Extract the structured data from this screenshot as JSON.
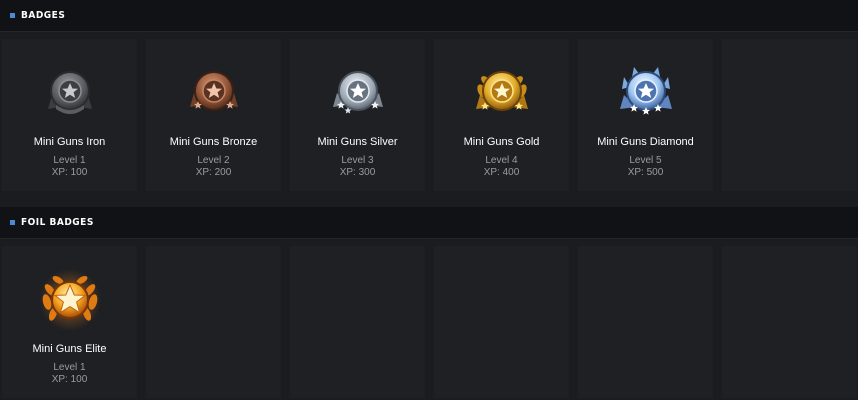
{
  "sections": [
    {
      "title": "BADGES",
      "badges": [
        {
          "name": "Mini Guns Iron",
          "level": "Level 1",
          "xp": "XP: 100",
          "icon": "iron-badge-icon"
        },
        {
          "name": "Mini Guns Bronze",
          "level": "Level 2",
          "xp": "XP: 200",
          "icon": "bronze-badge-icon"
        },
        {
          "name": "Mini Guns Silver",
          "level": "Level 3",
          "xp": "XP: 300",
          "icon": "silver-badge-icon"
        },
        {
          "name": "Mini Guns Gold",
          "level": "Level 4",
          "xp": "XP: 400",
          "icon": "gold-badge-icon"
        },
        {
          "name": "Mini Guns Diamond",
          "level": "Level 5",
          "xp": "XP: 500",
          "icon": "diamond-badge-icon"
        }
      ]
    },
    {
      "title": "FOIL BADGES",
      "badges": [
        {
          "name": "Mini Guns Elite",
          "level": "Level 1",
          "xp": "XP: 100",
          "icon": "elite-foil-badge-icon"
        }
      ]
    }
  ],
  "colors": {
    "accent": "#4d8ad6",
    "iron": "#6b6d72",
    "bronze": "#9a5a3d",
    "silver": "#b9c3cf",
    "gold": "#e4ad2a",
    "diamond": "#9cc4f2",
    "elite": "#f08a1e"
  }
}
